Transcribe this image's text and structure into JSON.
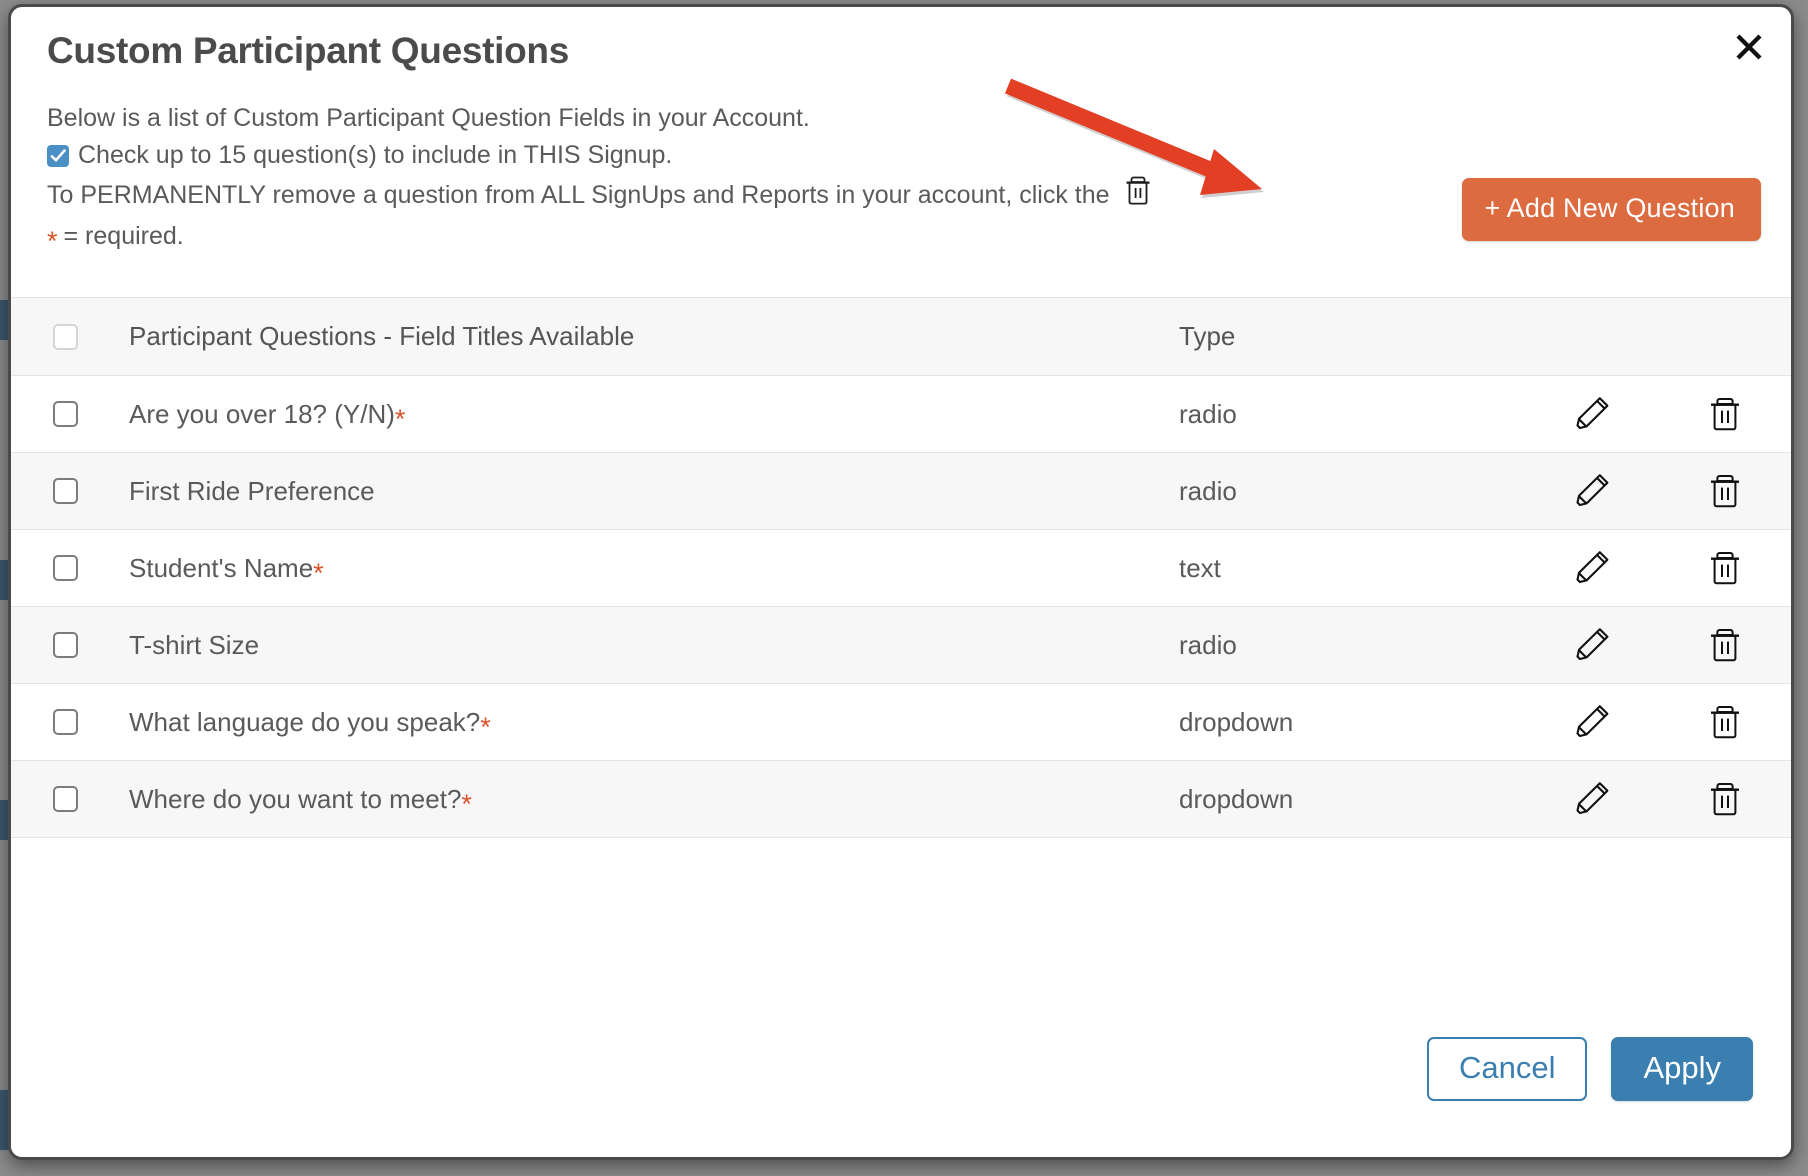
{
  "modal": {
    "title": "Custom Participant Questions",
    "close_icon": "close-icon",
    "intro": {
      "line1": "Below is a list of Custom Participant Question Fields in your Account.",
      "line2": "Check up to 15 question(s) to include in THIS Signup.",
      "line2_icon": "checked-checkbox-icon",
      "line3": "To PERMANENTLY remove a question from ALL SignUps and Reports in your account, click the",
      "line3_icon": "trash-icon",
      "line4_star": "*",
      "line4": "= required."
    },
    "add_button": {
      "label": "+ Add New Question",
      "color": "#dd6b40"
    },
    "annotation": {
      "type": "arrow",
      "color": "#e33f25"
    }
  },
  "table": {
    "columns": {
      "select_all": "",
      "title": "Participant Questions - Field Titles Available",
      "type": "Type",
      "edit": "",
      "delete": ""
    },
    "rows": [
      {
        "checked": false,
        "title": "Are you over 18? (Y/N)",
        "required": true,
        "type": "radio",
        "edit_icon": "pencil-icon",
        "delete_icon": "trash-icon"
      },
      {
        "checked": false,
        "title": "First Ride Preference",
        "required": false,
        "type": "radio",
        "edit_icon": "pencil-icon",
        "delete_icon": "trash-icon"
      },
      {
        "checked": false,
        "title": "Student's Name",
        "required": true,
        "type": "text",
        "edit_icon": "pencil-icon",
        "delete_icon": "trash-icon"
      },
      {
        "checked": false,
        "title": "T-shirt Size",
        "required": false,
        "type": "radio",
        "edit_icon": "pencil-icon",
        "delete_icon": "trash-icon"
      },
      {
        "checked": false,
        "title": "What language do you speak?",
        "required": true,
        "type": "dropdown",
        "edit_icon": "pencil-icon",
        "delete_icon": "trash-icon"
      },
      {
        "checked": false,
        "title": "Where do you want to meet?",
        "required": true,
        "type": "dropdown",
        "edit_icon": "pencil-icon",
        "delete_icon": "trash-icon"
      }
    ]
  },
  "footer": {
    "cancel_label": "Cancel",
    "apply_label": "Apply",
    "cancel_color": "#3b7fb0",
    "apply_color": "#3b7fb0"
  },
  "colors": {
    "accent_orange": "#dd6b40",
    "accent_blue": "#3b7fb0",
    "required_star": "#d9542b",
    "annotation_red": "#e33f25",
    "row_alt": "#f7f7f7"
  }
}
